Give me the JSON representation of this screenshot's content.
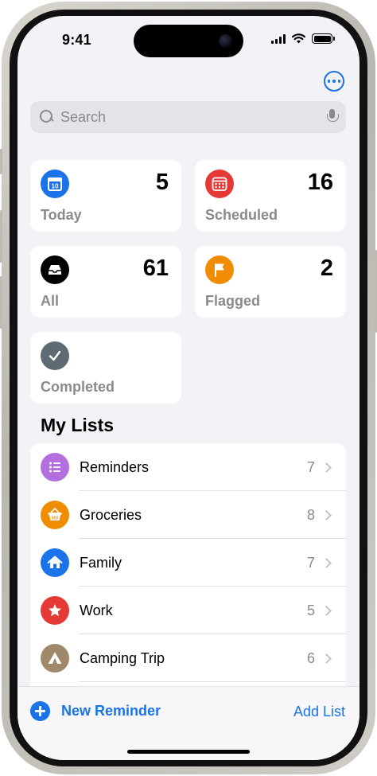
{
  "status_bar": {
    "time": "9:41"
  },
  "search": {
    "placeholder": "Search"
  },
  "smart_lists": [
    {
      "label": "Today",
      "count": "5",
      "color": "#1a73e8",
      "icon": "calendar-today-icon"
    },
    {
      "label": "Scheduled",
      "count": "16",
      "color": "#e53935",
      "icon": "calendar-icon"
    },
    {
      "label": "All",
      "count": "61",
      "color": "#000000",
      "icon": "tray-icon"
    },
    {
      "label": "Flagged",
      "count": "2",
      "color": "#f08c00",
      "icon": "flag-icon"
    },
    {
      "label": "Completed",
      "color": "#5f6b73",
      "icon": "checkmark-icon"
    }
  ],
  "today_icon_day": "10",
  "my_lists": {
    "title": "My Lists",
    "items": [
      {
        "label": "Reminders",
        "count": "7",
        "color": "#b36ee0",
        "icon": "list-bullet-icon"
      },
      {
        "label": "Groceries",
        "count": "8",
        "color": "#f08c00",
        "icon": "basket-icon"
      },
      {
        "label": "Family",
        "count": "7",
        "color": "#1a73e8",
        "icon": "house-icon"
      },
      {
        "label": "Work",
        "count": "5",
        "color": "#e53935",
        "icon": "star-icon"
      },
      {
        "label": "Camping Trip",
        "count": "6",
        "color": "#a0896a",
        "icon": "tent-icon"
      }
    ]
  },
  "toolbar": {
    "new_reminder": "New Reminder",
    "add_list": "Add List"
  }
}
